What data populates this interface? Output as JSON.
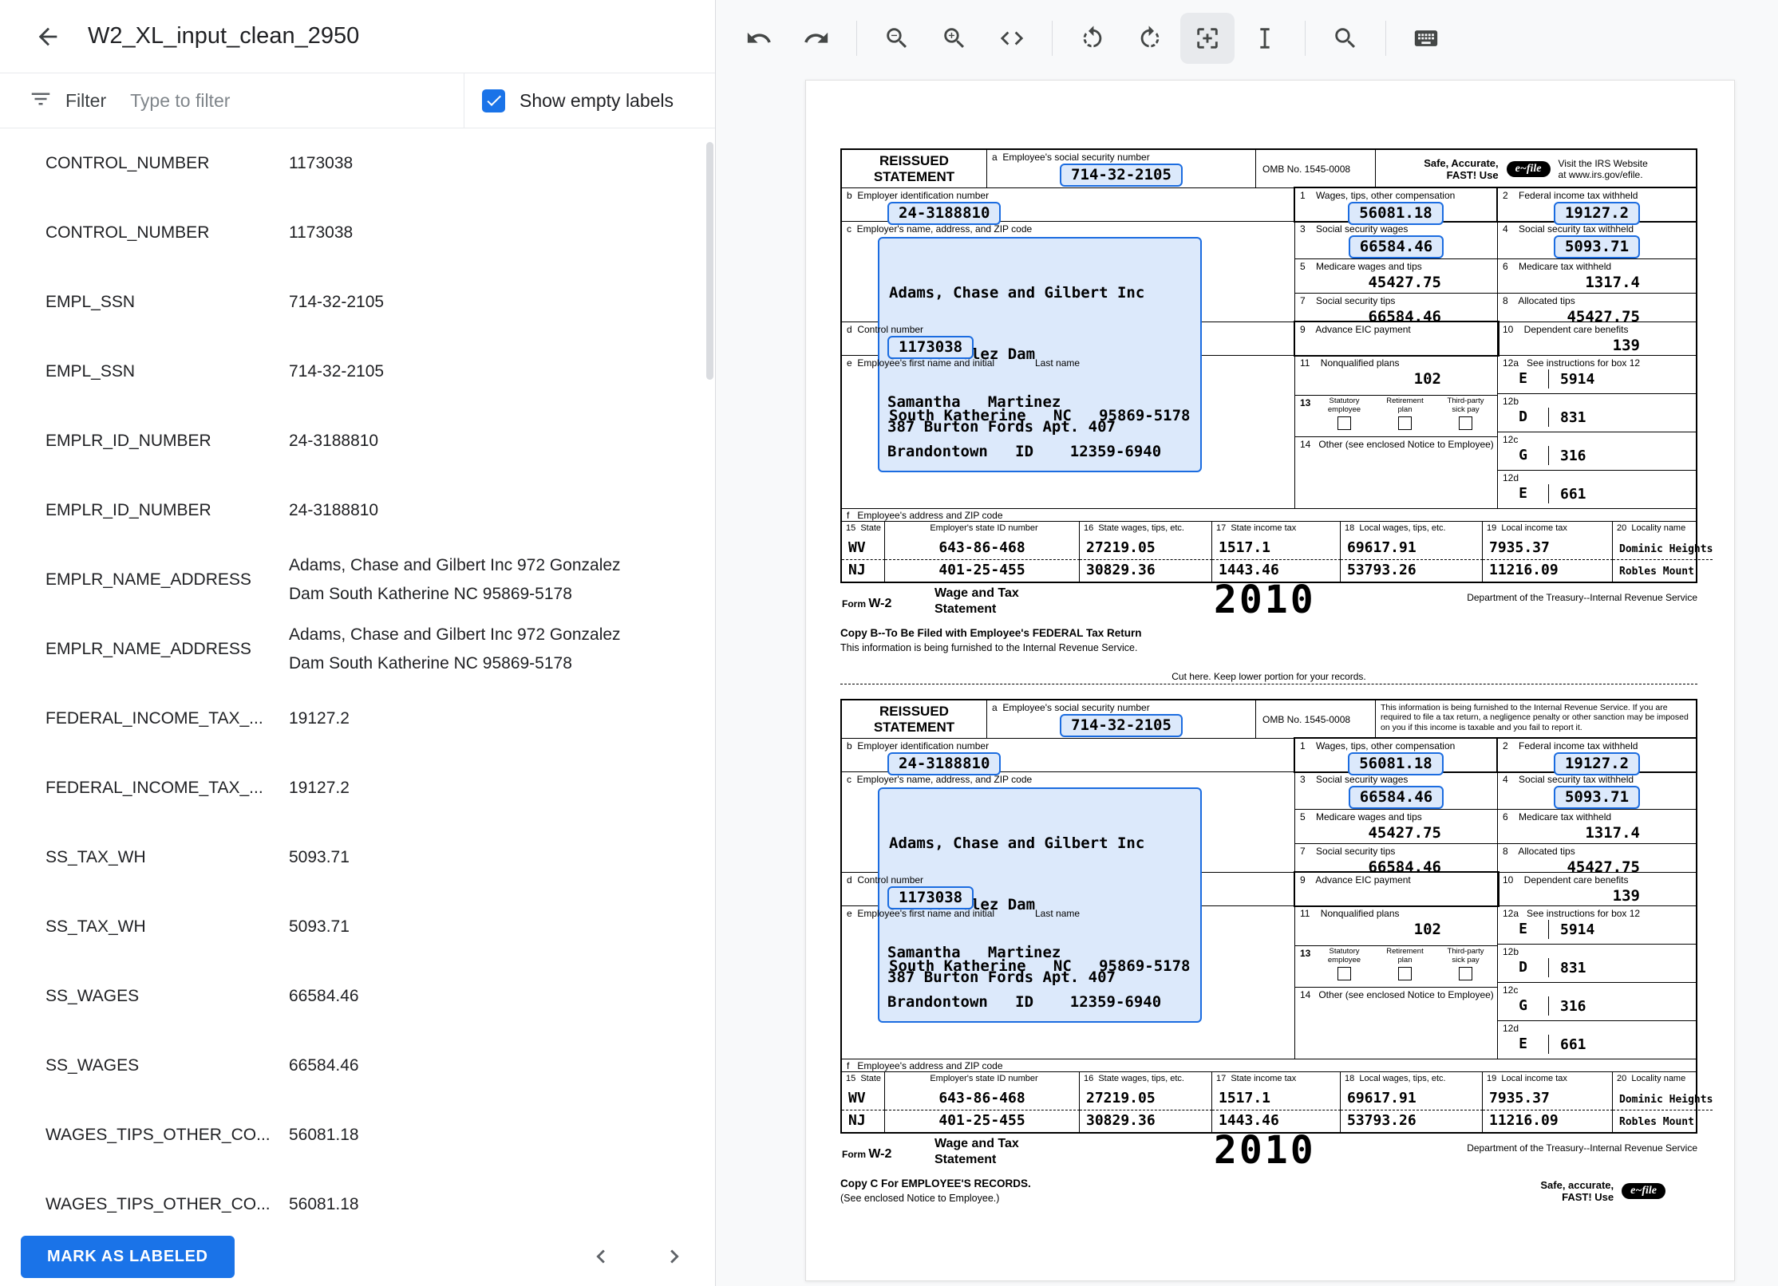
{
  "header": {
    "title": "W2_XL_input_clean_2950"
  },
  "filter": {
    "label": "Filter",
    "placeholder": "Type to filter",
    "show_empty_label": "Show empty labels",
    "checked": true
  },
  "labels": [
    {
      "name": "CONTROL_NUMBER",
      "value": "1173038"
    },
    {
      "name": "CONTROL_NUMBER",
      "value": "1173038"
    },
    {
      "name": "EMPL_SSN",
      "value": "714-32-2105"
    },
    {
      "name": "EMPL_SSN",
      "value": "714-32-2105"
    },
    {
      "name": "EMPLR_ID_NUMBER",
      "value": "24-3188810"
    },
    {
      "name": "EMPLR_ID_NUMBER",
      "value": "24-3188810"
    },
    {
      "name": "EMPLR_NAME_ADDRESS",
      "value": "Adams, Chase and Gilbert Inc 972 Gonzalez Dam South Katherine NC 95869-5178"
    },
    {
      "name": "EMPLR_NAME_ADDRESS",
      "value": "Adams, Chase and Gilbert Inc 972 Gonzalez Dam South Katherine NC 95869-5178"
    },
    {
      "name": "FEDERAL_INCOME_TAX_...",
      "value": "19127.2"
    },
    {
      "name": "FEDERAL_INCOME_TAX_...",
      "value": "19127.2"
    },
    {
      "name": "SS_TAX_WH",
      "value": "5093.71"
    },
    {
      "name": "SS_TAX_WH",
      "value": "5093.71"
    },
    {
      "name": "SS_WAGES",
      "value": "66584.46"
    },
    {
      "name": "SS_WAGES",
      "value": "66584.46"
    },
    {
      "name": "WAGES_TIPS_OTHER_CO...",
      "value": "56081.18"
    },
    {
      "name": "WAGES_TIPS_OTHER_CO...",
      "value": "56081.18"
    }
  ],
  "footer": {
    "mark_as_labeled": "MARK AS LABELED"
  },
  "toolbar": {
    "tools": [
      "undo",
      "redo",
      "zoom-out",
      "zoom-in",
      "code",
      "rotate-left",
      "rotate-right",
      "add-annotation",
      "text-select",
      "search",
      "keyboard"
    ],
    "active_tool": "add-annotation"
  },
  "w2": {
    "reissued_line1": "REISSUED",
    "reissued_line2": "STATEMENT",
    "box_a_label": "a  Employee's social security number",
    "ssn": "714-32-2105",
    "omb": "OMB No. 1545-0008",
    "efile": {
      "line1": "Safe, Accurate,",
      "line2": "FAST!  Use",
      "logo": "e~file",
      "site1": "Visit the IRS Website",
      "site2": "at www.irs.gov/efile."
    },
    "notice": "This information is being furnished to the Internal Revenue Service. If you are required to file a tax return, a negligence penalty or other sanction may be imposed on you if this income is taxable and you fail to report it.",
    "box_b_label": "b  Employer identification number",
    "ein": "24-3188810",
    "box1_label": "1    Wages, tips, other compensation",
    "box1": "56081.18",
    "box2_label": "2    Federal income tax withheld",
    "box2": "19127.2",
    "box_c_label": "c  Employer's name, address, and ZIP code",
    "employer_name": "Adams, Chase and Gilbert Inc",
    "employer_addr1": "972 Gonzalez Dam",
    "employer_addr2": "South Katherine   NC   95869-5178",
    "box3_label": "3    Social security wages",
    "box3": "66584.46",
    "box4_label": "4    Social security tax withheld",
    "box4": "5093.71",
    "box5_label": "5    Medicare wages and tips",
    "box5": "45427.75",
    "box6_label": "6    Medicare tax withheld",
    "box6": "1317.4",
    "box7_label": "7    Social security tips",
    "box7": "66584.46",
    "box8_label": "8    Allocated tips",
    "box8": "45427.75",
    "box_d_label": "d  Control number",
    "control_number": "1173038",
    "box9_label": "9    Advance EIC payment",
    "box10_label": "10    Dependent care benefits",
    "box10": "139",
    "box_e_label": "e  Employee's first name and initial",
    "box_e_label2": "Last name",
    "employee_name": "Samantha   Martinez",
    "employee_addr1": "387 Burton Fords Apt. 407",
    "employee_addr2": "Brandontown   ID    12359-6940",
    "box11_label": "11    Nonqualified plans",
    "box11": "102",
    "box13_label": "13",
    "box13_opts": [
      "Statutory employee",
      "Retirement plan",
      "Third-party sick pay"
    ],
    "box14_label": "14   Other (see enclosed Notice to Employee)",
    "box12a_label": "12a   See instructions for box 12",
    "box12a_code": "E",
    "box12a": "5914",
    "box12b_label": "12b",
    "box12b_code": "D",
    "box12b": "831",
    "box12c_label": "12c",
    "box12c_code": "G",
    "box12c": "316",
    "box12d_label": "12d",
    "box12d_code": "E",
    "box12d": "661",
    "box_f_label": "f   Employee's address and ZIP code",
    "state_headers": [
      "15  State",
      "Employer's state ID number",
      "16  State wages, tips, etc.",
      "17  State income tax",
      "18  Local wages, tips, etc.",
      "19  Local income tax",
      "20  Locality name"
    ],
    "state_rows": [
      [
        "WV",
        "643-86-468",
        "27219.05",
        "1517.1",
        "69617.91",
        "7935.37",
        "Dominic Heights"
      ],
      [
        "NJ",
        "401-25-455",
        "30829.36",
        "1443.46",
        "53793.26",
        "11216.09",
        "Robles Mount"
      ]
    ],
    "form_label_small": "Form",
    "form_label_big": "W-2",
    "title_line1": "Wage and Tax",
    "title_line2": "Statement",
    "year": "2010",
    "department": "Department of the Treasury--Internal Revenue Service",
    "cut_line": "Cut here.  Keep lower portion for your records.",
    "footer_efile_line1": "Safe, accurate,",
    "footer_efile_line2": "FAST!  Use",
    "copies": [
      {
        "show_efile": true,
        "show_notice": false,
        "copy_line1": "Copy B--To Be Filed with Employee's FEDERAL Tax Return",
        "copy_line2": "This information is being furnished to the Internal Revenue Service.",
        "show_footer_efile": false,
        "show_cut": true
      },
      {
        "show_efile": false,
        "show_notice": true,
        "copy_line1": "Copy C For EMPLOYEE'S RECORDS.",
        "copy_line2": "(See enclosed Notice to Employee.)",
        "show_footer_efile": true,
        "show_cut": false
      }
    ]
  }
}
